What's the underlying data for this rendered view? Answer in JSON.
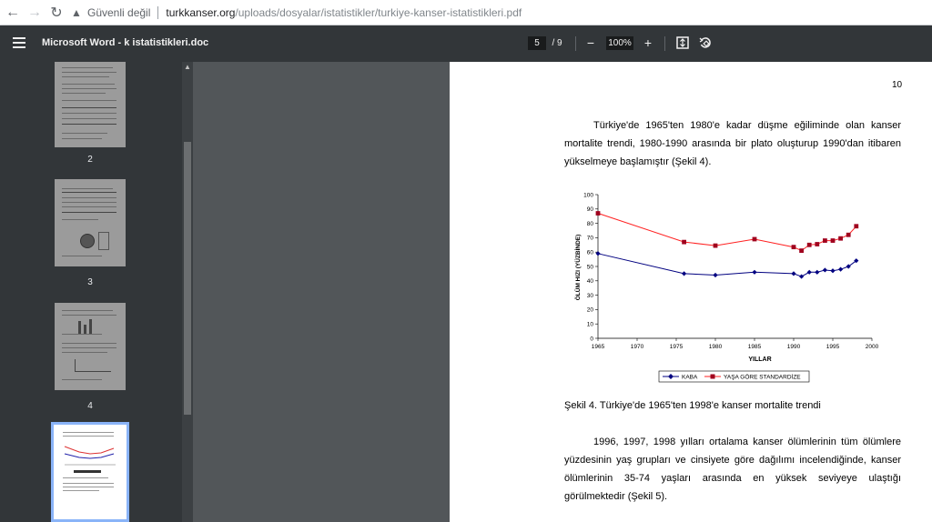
{
  "browser": {
    "security_label": "Güvenli değil",
    "url_host": "turkkanser.org",
    "url_path": "/uploads/dosyalar/istatistikler/turkiye-kanser-istatistikleri.pdf"
  },
  "pdf_toolbar": {
    "title": "Microsoft Word - k istatistikleri.doc",
    "current_page": "5",
    "total_pages": "/ 9",
    "zoom": "100%"
  },
  "sidebar": {
    "thumbnails": [
      {
        "label": "2"
      },
      {
        "label": "3"
      },
      {
        "label": "4"
      }
    ]
  },
  "document": {
    "page_number": "10",
    "paragraph1": "Türkiye'de 1965'ten 1980'e kadar düşme eğiliminde olan kanser mortalite trendi, 1980-1990 arasında bir plato oluşturup 1990'dan itibaren yükselmeye başlamıştır (Şekil 4).",
    "caption": "Şekil 4. Türkiye'de 1965'ten 1998'e kanser mortalite trendi",
    "paragraph2": "1996, 1997, 1998 yılları ortalama kanser ölümlerinin tüm ölümlere yüzdesinin yaş grupları ve cinsiyete göre dağılımı incelendiğinde, kanser ölümlerinin 35-74 yaşları arasında en yüksek seviyeye ulaştığı görülmektedir (Şekil 5)."
  },
  "chart_data": {
    "type": "line",
    "xlabel": "YILLAR",
    "ylabel": "ÖLÜM HIZI (YÜZBİNDE)",
    "xlim": [
      1965,
      2000
    ],
    "ylim": [
      0,
      100
    ],
    "x_ticks": [
      "1965",
      "1970",
      "1975",
      "1980",
      "1985",
      "1990",
      "1995",
      "2000"
    ],
    "y_ticks": [
      "0",
      "10",
      "20",
      "30",
      "40",
      "50",
      "60",
      "70",
      "80",
      "90",
      "100"
    ],
    "legend_position": "bottom",
    "series": [
      {
        "name": "KABA",
        "color": "#000080",
        "marker": "diamond",
        "points": [
          [
            1965,
            59
          ],
          [
            1976,
            45
          ],
          [
            1980,
            44
          ],
          [
            1985,
            46
          ],
          [
            1990,
            45
          ],
          [
            1991,
            43
          ],
          [
            1992,
            46
          ],
          [
            1993,
            46
          ],
          [
            1994,
            47.5
          ],
          [
            1995,
            47
          ],
          [
            1996,
            48
          ],
          [
            1997,
            50
          ],
          [
            1998,
            54
          ]
        ]
      },
      {
        "name": "YAŞA GÖRE STANDARDİZE",
        "color": "#a0001e",
        "line_color": "#ff2020",
        "marker": "square",
        "points": [
          [
            1965,
            87
          ],
          [
            1976,
            67
          ],
          [
            1980,
            64.5
          ],
          [
            1985,
            69
          ],
          [
            1990,
            63.5
          ],
          [
            1991,
            61
          ],
          [
            1992,
            65
          ],
          [
            1993,
            65.5
          ],
          [
            1994,
            68
          ],
          [
            1995,
            68
          ],
          [
            1996,
            69.5
          ],
          [
            1997,
            72
          ],
          [
            1998,
            78
          ]
        ]
      }
    ]
  }
}
